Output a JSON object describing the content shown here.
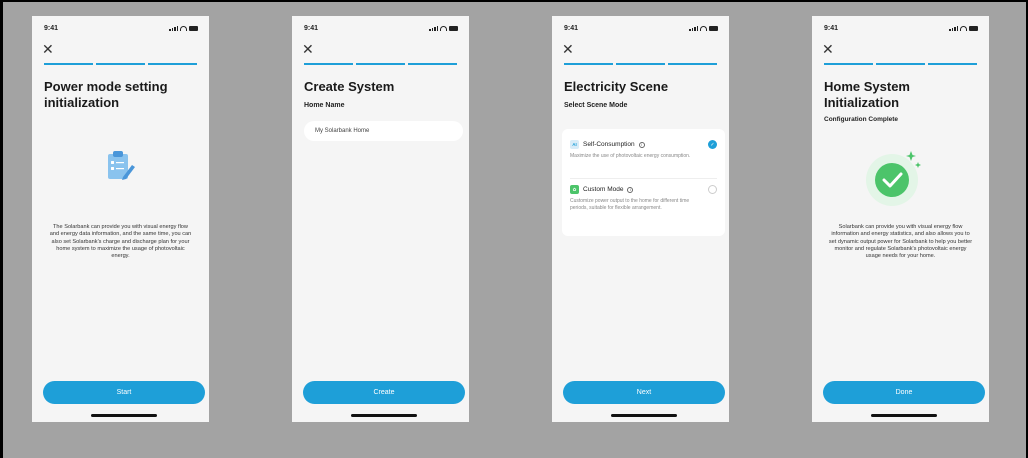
{
  "status": {
    "time": "9:41"
  },
  "colors": {
    "accent": "#1e9fd8",
    "success": "#4cc46a",
    "background": "#a3a3a3"
  },
  "screens": [
    {
      "title": "Power mode setting initialization",
      "illustration": "clipboard-edit-icon",
      "description": "The Solarbank can provide you with visual energy flow and energy data information, and the same time, you can also set Solarbank's charge and discharge plan for your home system to maximize the usage of photovoltaic energy.",
      "button": "Start"
    },
    {
      "title": "Create System",
      "field_label": "Home Name",
      "field_value": "My Solarbank Home",
      "button": "Create"
    },
    {
      "title": "Electricity Scene",
      "subtitle": "Select Scene Mode",
      "options": [
        {
          "icon_label": "AI",
          "label": "Self-Consumption",
          "description": "Maximize the use of photovoltaic energy consumption.",
          "selected": true
        },
        {
          "icon_label": "✿",
          "label": "Custom Mode",
          "description": "Customize power output to the home for different time periods, suitable for flexible arrangement.",
          "selected": false
        }
      ],
      "button": "Next"
    },
    {
      "title": "Home System Initialization",
      "subtitle": "Configuration Complete",
      "description": "Solarbank can provide you with visual energy flow information and energy statistics, and also allows you to set dynamic output power for Solarbank to help you better monitor and regulate Solarbank's photovoltaic energy usage needs for your home.",
      "button": "Done"
    }
  ]
}
